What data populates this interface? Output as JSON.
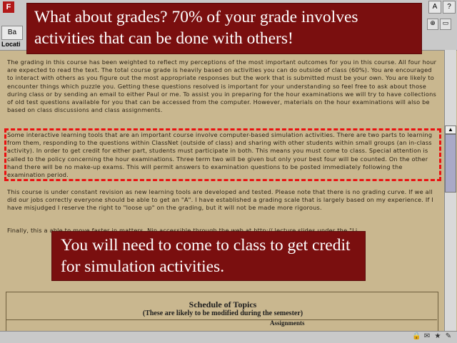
{
  "browser": {
    "menu_stub": "F",
    "toolbar_back_stub": "Ba",
    "location_stub": "Locati",
    "tray_icons": [
      "A",
      "?"
    ]
  },
  "page": {
    "paragraph_1": "The grading in this course has been weighted to reflect my perceptions of the most important outcomes for you in this course. All four hour are expected to read the text. The total course grade is heavily based on activities you can do outside of class (60%). You are encouraged to interact with others as you figure out the most appropriate responses but the work that is submitted must be your own. You are likely to encounter things which puzzle you. Getting these questions resolved is important for your understanding so feel free to ask about those during class or by sending an email to either Paul or me. To assist you in preparing for the hour examinations we will try to have collections of old test questions available for you that can be accessed from the computer. However, materials on the hour examinations will also be based on class discussions and class assignments.",
    "paragraph_2": "Some interactive learning tools that are an important course involve computer-based simulation activities. There are two parts to learning from them, responding to the questions within ClassNet (outside of class) and sharing with other students within small groups (an in-class activity). In order to get credit for either part, students must participate in both. This means you must come to class. Special attention is called to the policy concerning the hour examinations. Three term two will be given but only your best four will be counted. On the other hand there will be no make-up exams. This will permit answers to examination questions to be posted immediately following the examination period.",
    "paragraph_3": "This course is under constant revision as new learning tools are developed and tested. Please note that there is no grading curve. If we all did our jobs correctly everyone should be able to get an \"A\". I have established a grading scale that is largely based on my experience. If I have misjudged I reserve the right to \"loose up\" on the grading, but it will not be made more rigorous.",
    "paragraph_4": "Finally, this a able to move faster in matters. Nin accessible through the web at http:// lecture slides under the \"Li",
    "schedule_title": "Schedule of Topics",
    "schedule_subtitle": "(These are likely to be modified during the semester)",
    "assignments_header": "Assignments"
  },
  "overlay": {
    "top_callout": "What about grades? 70% of your grade involves activities that can be done with others!",
    "bottom_callout": "You will need to come to class to get credit for simulation activities."
  },
  "colors": {
    "page_background": "#c9b78f",
    "callout_background": "#7a0f0f",
    "dashed_highlight": "#ea1111"
  }
}
